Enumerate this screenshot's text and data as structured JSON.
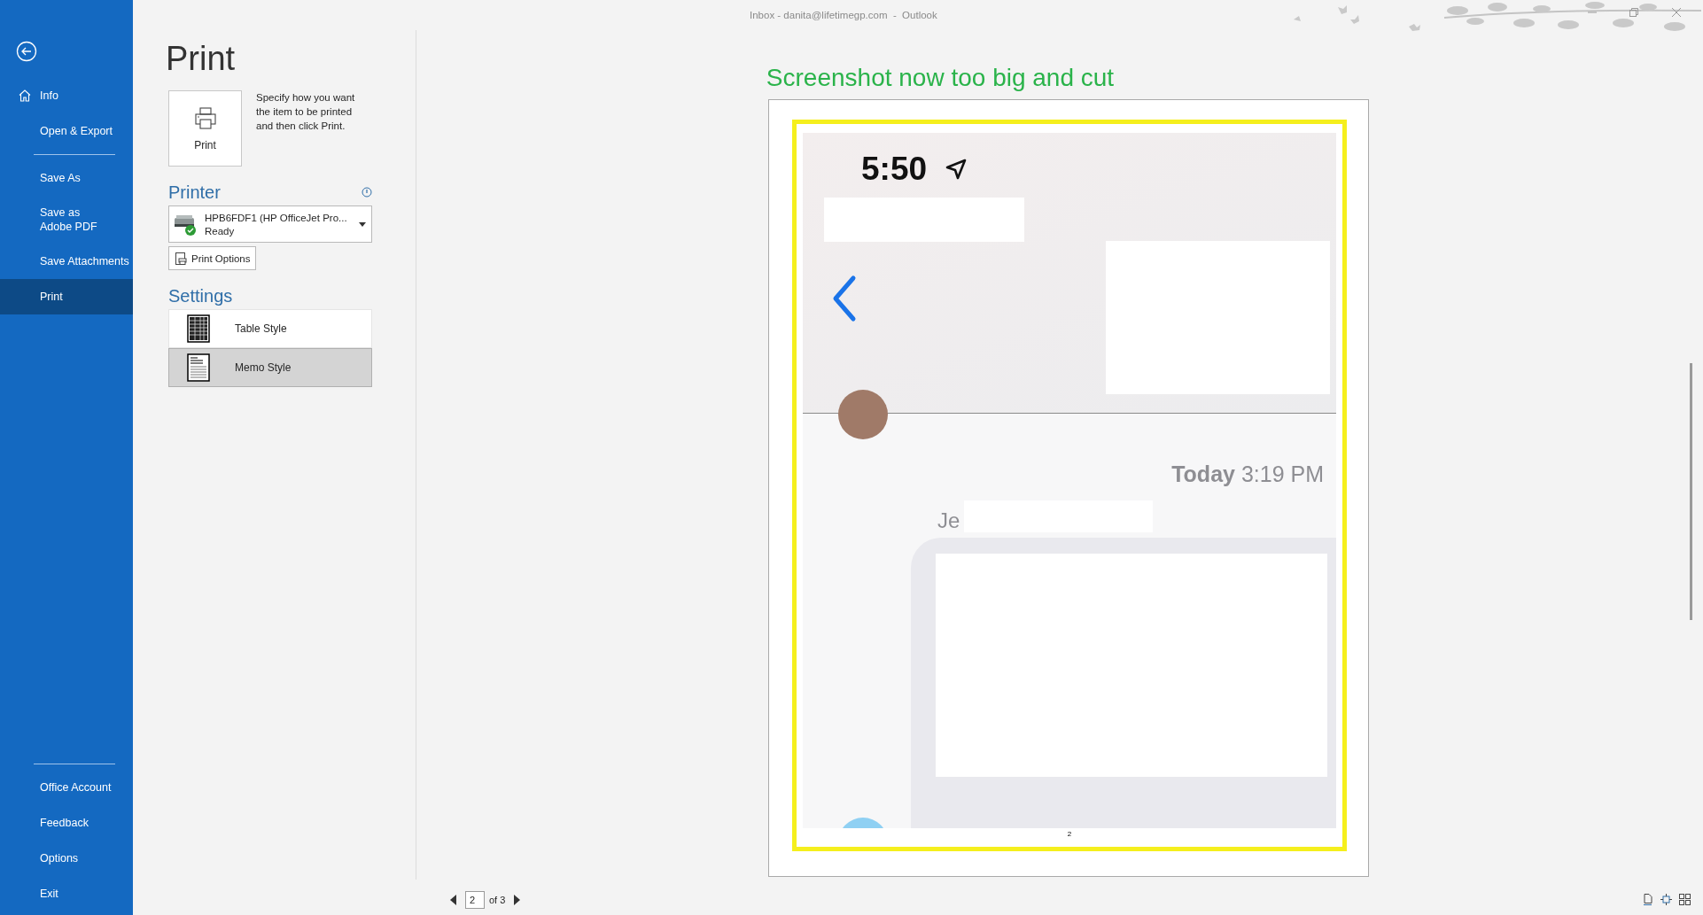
{
  "window": {
    "title": "Inbox - danita@lifetimegp.com  -  Outlook"
  },
  "nav": {
    "top": [
      {
        "label": "Info",
        "selected": false
      },
      {
        "label": "Open & Export",
        "selected": false
      }
    ],
    "middle": [
      {
        "label": "Save As",
        "selected": false
      },
      {
        "label": "Save as Adobe PDF",
        "selected": false
      },
      {
        "label": "Save Attachments",
        "selected": false
      },
      {
        "label": "Print",
        "selected": true
      }
    ],
    "bottom": [
      {
        "label": "Office Account",
        "selected": false
      },
      {
        "label": "Feedback",
        "selected": false
      },
      {
        "label": "Options",
        "selected": false
      },
      {
        "label": "Exit",
        "selected": false
      }
    ]
  },
  "page_title": "Print",
  "print_button": {
    "label": "Print"
  },
  "description": "Specify how you want the item to be printed and then click Print.",
  "printer": {
    "heading": "Printer",
    "name": "HPB6FDF1 (HP OfficeJet Pro...",
    "status": "Ready"
  },
  "print_options": {
    "label": "Print Options"
  },
  "settings": {
    "heading": "Settings",
    "styles": [
      {
        "label": "Table Style",
        "selected": false,
        "kind": "table"
      },
      {
        "label": "Memo Style",
        "selected": true,
        "kind": "memo"
      }
    ]
  },
  "preview": {
    "annotation": "Screenshot now too big and cut",
    "phone": {
      "time": "5:50",
      "timestamp": "**Today** 3:19 PM",
      "sender": "Je"
    },
    "page_number": "2"
  },
  "page_nav": {
    "page": "2",
    "total": "of 3"
  }
}
